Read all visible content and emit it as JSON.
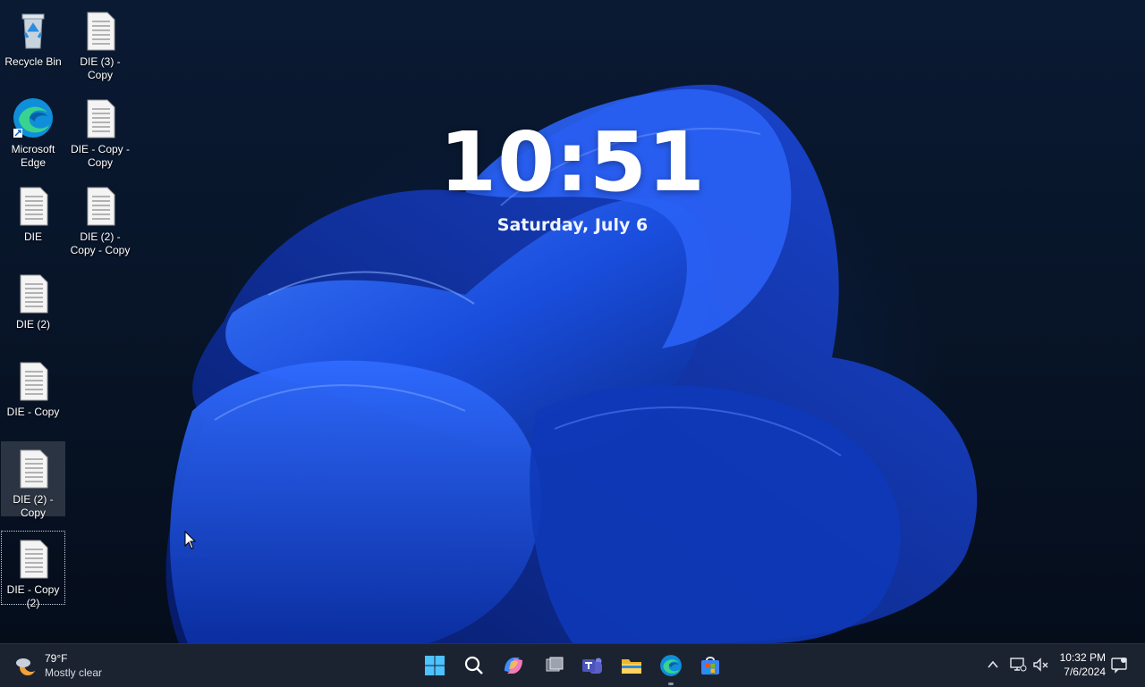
{
  "lock": {
    "time": "10:51",
    "date": "Saturday, July 6"
  },
  "desktop": {
    "icons": [
      {
        "label": "Recycle Bin",
        "icon": "recycle-bin-icon"
      },
      {
        "label": "DIE (3) - Copy",
        "icon": "text-file-icon"
      },
      {
        "label": "Microsoft Edge",
        "icon": "edge-icon"
      },
      {
        "label": "DIE - Copy - Copy",
        "icon": "text-file-icon"
      },
      {
        "label": "DIE",
        "icon": "text-file-icon"
      },
      {
        "label": "DIE (2) - Copy - Copy",
        "icon": "text-file-icon"
      },
      {
        "label": "DIE (2)",
        "icon": "text-file-icon"
      },
      {
        "label": "DIE - Copy",
        "icon": "text-file-icon"
      },
      {
        "label": "DIE (2) - Copy",
        "icon": "text-file-icon"
      },
      {
        "label": "DIE - Copy (2)",
        "icon": "text-file-icon"
      }
    ]
  },
  "taskbar": {
    "weather": {
      "temp": "79°F",
      "condition": "Mostly clear",
      "icon": "moon-cloud-icon"
    },
    "apps": [
      "start-icon",
      "search-icon",
      "copilot-icon",
      "task-view-icon",
      "teams-icon",
      "file-explorer-icon",
      "edge-icon",
      "microsoft-store-icon"
    ],
    "tray": {
      "time": "10:32 PM",
      "date": "7/6/2024",
      "icons": [
        "chevron-up-icon",
        "network-icon",
        "volume-muted-icon",
        "notification-icon"
      ]
    }
  },
  "colors": {
    "taskbar": "#1c2330",
    "wallpaper_blue": "#1f5bff",
    "accent": "#4cc2ff"
  }
}
